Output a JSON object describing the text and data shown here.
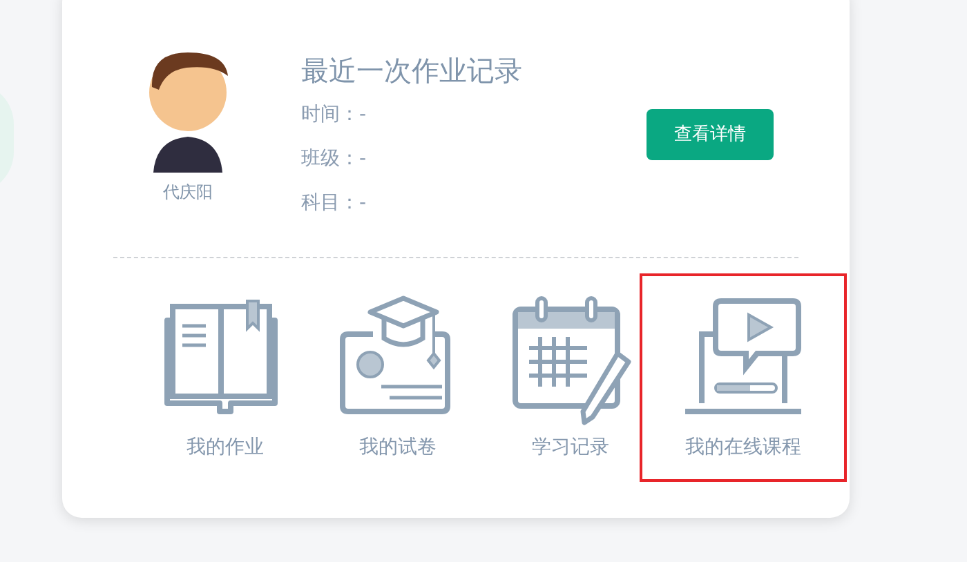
{
  "profile": {
    "name": "代庆阳"
  },
  "record": {
    "title": "最近一次作业记录",
    "lines": [
      "时间：-",
      "班级：-",
      "科目：-"
    ],
    "button": "查看详情"
  },
  "shortcuts": [
    {
      "kind": "book",
      "label": "我的作业",
      "selected": false
    },
    {
      "kind": "exam",
      "label": "我的试卷",
      "selected": false
    },
    {
      "kind": "calendar",
      "label": "学习记录",
      "selected": false
    },
    {
      "kind": "video",
      "label": "我的在线课程",
      "selected": true
    }
  ]
}
